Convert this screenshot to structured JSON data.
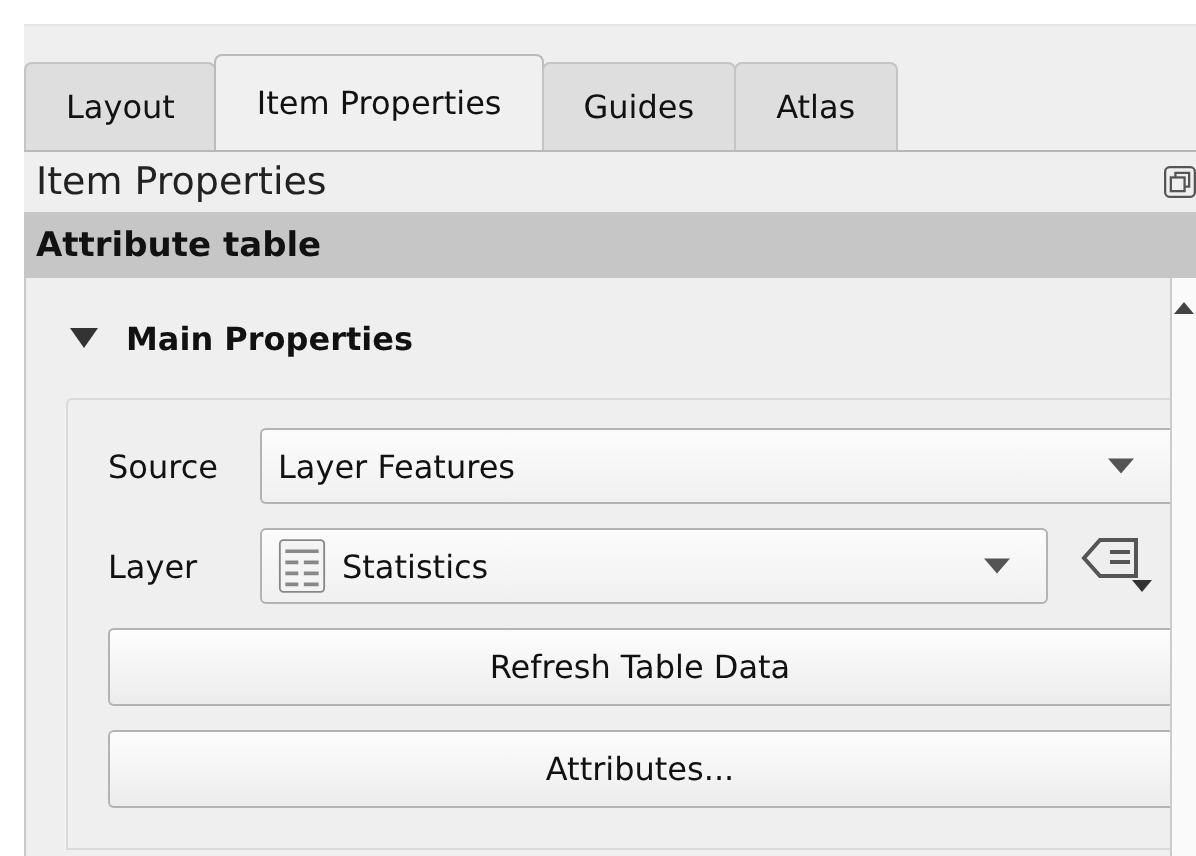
{
  "tabs": [
    {
      "label": "Layout",
      "selected": false
    },
    {
      "label": "Item Properties",
      "selected": true
    },
    {
      "label": "Guides",
      "selected": false
    },
    {
      "label": "Atlas",
      "selected": false
    }
  ],
  "panel": {
    "title": "Item Properties",
    "item_header": "Attribute table"
  },
  "group": {
    "title": "Main Properties",
    "expanded": true
  },
  "fields": [
    {
      "label": "Source",
      "value": "Layer Features",
      "kind": "combo"
    },
    {
      "label": "Layer",
      "value": "Statistics",
      "kind": "layer"
    }
  ],
  "buttons": [
    "Refresh Table Data",
    "Attributes..."
  ]
}
